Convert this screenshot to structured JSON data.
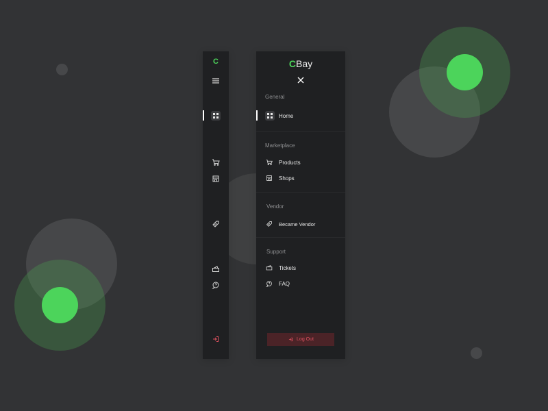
{
  "colors": {
    "background": "#323335",
    "panel": "#1f2022",
    "accent": "#4cd45b",
    "danger": "#e0515f",
    "danger_bg": "#4b2327"
  },
  "brand": {
    "letter": "C",
    "rest": "Bay"
  },
  "rail": {
    "logo": "C"
  },
  "sections": [
    {
      "title": "General",
      "items": [
        {
          "label": "Home",
          "icon": "grid-icon",
          "active": true
        }
      ]
    },
    {
      "title": "Marketplace",
      "items": [
        {
          "label": "Products",
          "icon": "cart-icon"
        },
        {
          "label": "Shops",
          "icon": "store-icon"
        }
      ]
    },
    {
      "title": "Vendor",
      "items": [
        {
          "label": "Became Vendor",
          "icon": "tag-icon"
        }
      ]
    },
    {
      "title": "Support",
      "items": [
        {
          "label": "Tickets",
          "icon": "ticket-icon"
        },
        {
          "label": "FAQ",
          "icon": "help-icon"
        }
      ]
    }
  ],
  "logout": {
    "label": "Log Out",
    "icon": "logout-icon"
  }
}
